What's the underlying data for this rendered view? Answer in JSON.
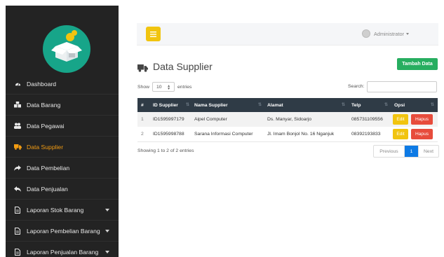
{
  "sidebar": {
    "items": [
      {
        "label": "Dashboard",
        "icon": "dashboard-icon"
      },
      {
        "label": "Data Barang",
        "icon": "cubes-icon"
      },
      {
        "label": "Data Pegawai",
        "icon": "users-icon"
      },
      {
        "label": "Data Supplier",
        "icon": "truck-icon",
        "active": true
      },
      {
        "label": "Data Pembelian",
        "icon": "share-icon"
      },
      {
        "label": "Data Penjualan",
        "icon": "reply-icon"
      },
      {
        "label": "Laporan Stok Barang",
        "icon": "file-icon"
      },
      {
        "label": "Laporan Pembelian Barang",
        "icon": "file-icon"
      },
      {
        "label": "Laporan Penjualan Barang",
        "icon": "file-icon"
      }
    ]
  },
  "topbar": {
    "user": "Administrator"
  },
  "page": {
    "title": "Data Supplier",
    "add_button": "Tambah Data"
  },
  "table_controls": {
    "show_label": "Show",
    "entries_value": "10",
    "entries_label": "entries",
    "search_label": "Search:",
    "search_value": ""
  },
  "table": {
    "headers": [
      "#",
      "ID Supplier",
      "Nama Supplier",
      "Alamat",
      "Telp",
      "Opsi"
    ],
    "rows": [
      [
        "1",
        "ID1595997179",
        "Aipel Computer",
        "Ds. Manyar, Sidoarjo",
        "085731109556"
      ],
      [
        "2",
        "ID1595998788",
        "Sarana Informasi Computer",
        "Jl. Imam Bonjol No. 16 Nganjuk",
        "08392193833"
      ]
    ],
    "edit_label": "Edit",
    "delete_label": "Hapus"
  },
  "footer": {
    "info": "Showing 1 to 2 of 2 entries",
    "prev": "Previous",
    "page": "1",
    "next": "Next"
  },
  "colors": {
    "sidebar_bg": "#232323",
    "active": "#f39c12",
    "header_bg": "#2f3b46",
    "add_green": "#27ae60",
    "edit_yellow": "#f1c40f",
    "delete_red": "#e74c3c",
    "page_blue": "#0d7ae5"
  }
}
